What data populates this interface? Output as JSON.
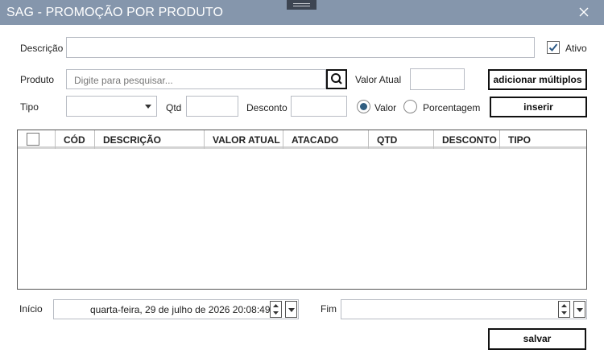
{
  "window": {
    "title": "SAG - PROMOÇÃO POR PRODUTO"
  },
  "form": {
    "descricao_label": "Descrição",
    "descricao_value": "",
    "ativo_label": "Ativo",
    "ativo_checked": true,
    "produto_label": "Produto",
    "produto_placeholder": "Digite para pesquisar...",
    "valor_atual_label": "Valor Atual",
    "valor_atual_value": "",
    "tipo_label": "Tipo",
    "tipo_value": "",
    "qtd_label": "Qtd",
    "qtd_value": "",
    "desconto_label": "Desconto",
    "desconto_value": "",
    "radio_valor_label": "Valor",
    "radio_porcentagem_label": "Porcentagem",
    "selected_radio": "Valor"
  },
  "buttons": {
    "adicionar_multiplos": "adicionar múltiplos",
    "inserir": "inserir",
    "salvar": "salvar"
  },
  "grid": {
    "columns": [
      "CÓD",
      "DESCRIÇÃO",
      "VALOR ATUAL",
      "ATACADO",
      "QTD",
      "DESCONTO",
      "TIPO"
    ],
    "rows": []
  },
  "dates": {
    "inicio_label": "Início",
    "inicio_value": "quarta-feira, 29 de julho de 2026 20:08:49",
    "fim_label": "Fim",
    "fim_value": ""
  },
  "icons": {
    "close": "close-icon",
    "search": "search-icon",
    "check": "checkmark-icon",
    "combo": "chevron-down-icon",
    "spin_up": "spin-up-icon",
    "spin_down": "spin-down-icon"
  }
}
